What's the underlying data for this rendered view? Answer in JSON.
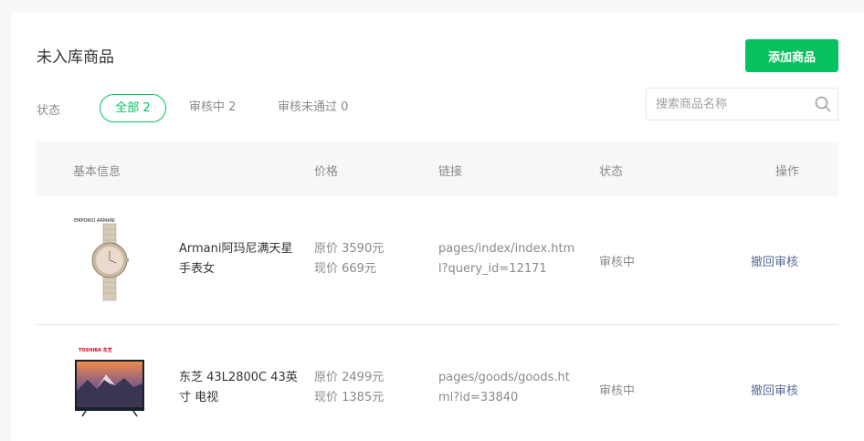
{
  "page": {
    "title": "未入库商品",
    "add_button": "添加商品"
  },
  "filters": {
    "label": "状态",
    "tabs": [
      {
        "label": "全部 2",
        "active": true
      },
      {
        "label": "审核中 2",
        "active": false
      },
      {
        "label": "审核未通过 0",
        "active": false
      }
    ]
  },
  "search": {
    "placeholder": "搜索商品名称",
    "icon": "search-icon"
  },
  "table": {
    "headers": {
      "info": "基本信息",
      "price": "价格",
      "link": "链接",
      "status": "状态",
      "action": "操作"
    },
    "rows": [
      {
        "thumb_icon": "watch-product-image",
        "brand_text": "EMPORIO ARMANI",
        "name": "Armani阿玛尼满天星手表女",
        "original_price": "原价 3590元",
        "current_price": "现价 669元",
        "link": "pages/index/index.html?query_id=12171",
        "status": "审核中",
        "action": "撤回审核"
      },
      {
        "thumb_icon": "tv-product-image",
        "brand_text": "TOSHIBA 东芝",
        "name": "东芝 43L2800C 43英寸 电视",
        "original_price": "原价 2499元",
        "current_price": "现价 1385元",
        "link": "pages/goods/goods.html?id=33840",
        "status": "审核中",
        "action": "撤回审核"
      }
    ]
  },
  "colors": {
    "accent": "#07c160",
    "link": "#576b95",
    "muted": "#8a8a8a",
    "header_bg": "#f6f7f9"
  }
}
